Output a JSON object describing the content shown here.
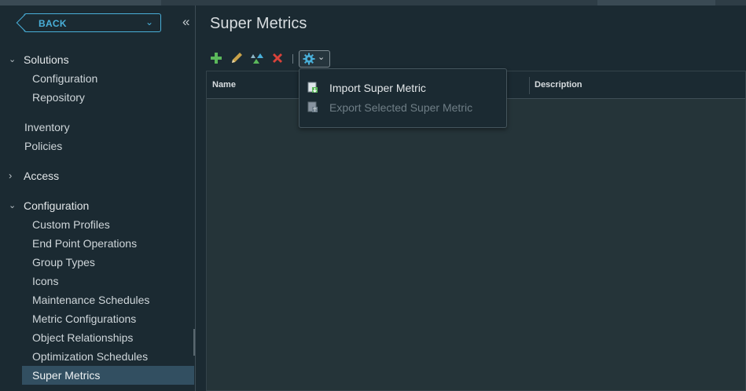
{
  "colors": {
    "accent": "#49afd9",
    "add": "#5bb85b",
    "edit": "#c9a24a",
    "delete": "#d9423a",
    "gear": "#49afd9",
    "active_nav": "#324f61"
  },
  "sidebar": {
    "back_label": "BACK",
    "groups": [
      {
        "label": "Solutions",
        "expanded": true,
        "items": [
          "Configuration",
          "Repository"
        ]
      },
      {
        "label": "Access",
        "expanded": false,
        "items": []
      },
      {
        "label": "Configuration",
        "expanded": true,
        "items": [
          "Custom Profiles",
          "End Point Operations",
          "Group Types",
          "Icons",
          "Maintenance Schedules",
          "Metric Configurations",
          "Object Relationships",
          "Optimization Schedules",
          "Super Metrics"
        ]
      }
    ],
    "top_items": [
      "Inventory",
      "Policies"
    ],
    "active_item": "Super Metrics"
  },
  "main": {
    "title": "Super Metrics",
    "toolbar": {
      "icons": [
        "add-icon",
        "edit-icon",
        "clone-icon",
        "delete-icon",
        "gear-icon"
      ]
    },
    "grid": {
      "columns": [
        "Name",
        "Description"
      ]
    },
    "dropdown": {
      "items": [
        {
          "label": "Import Super Metric",
          "enabled": true
        },
        {
          "label": "Export Selected Super Metric",
          "enabled": false
        }
      ]
    }
  }
}
